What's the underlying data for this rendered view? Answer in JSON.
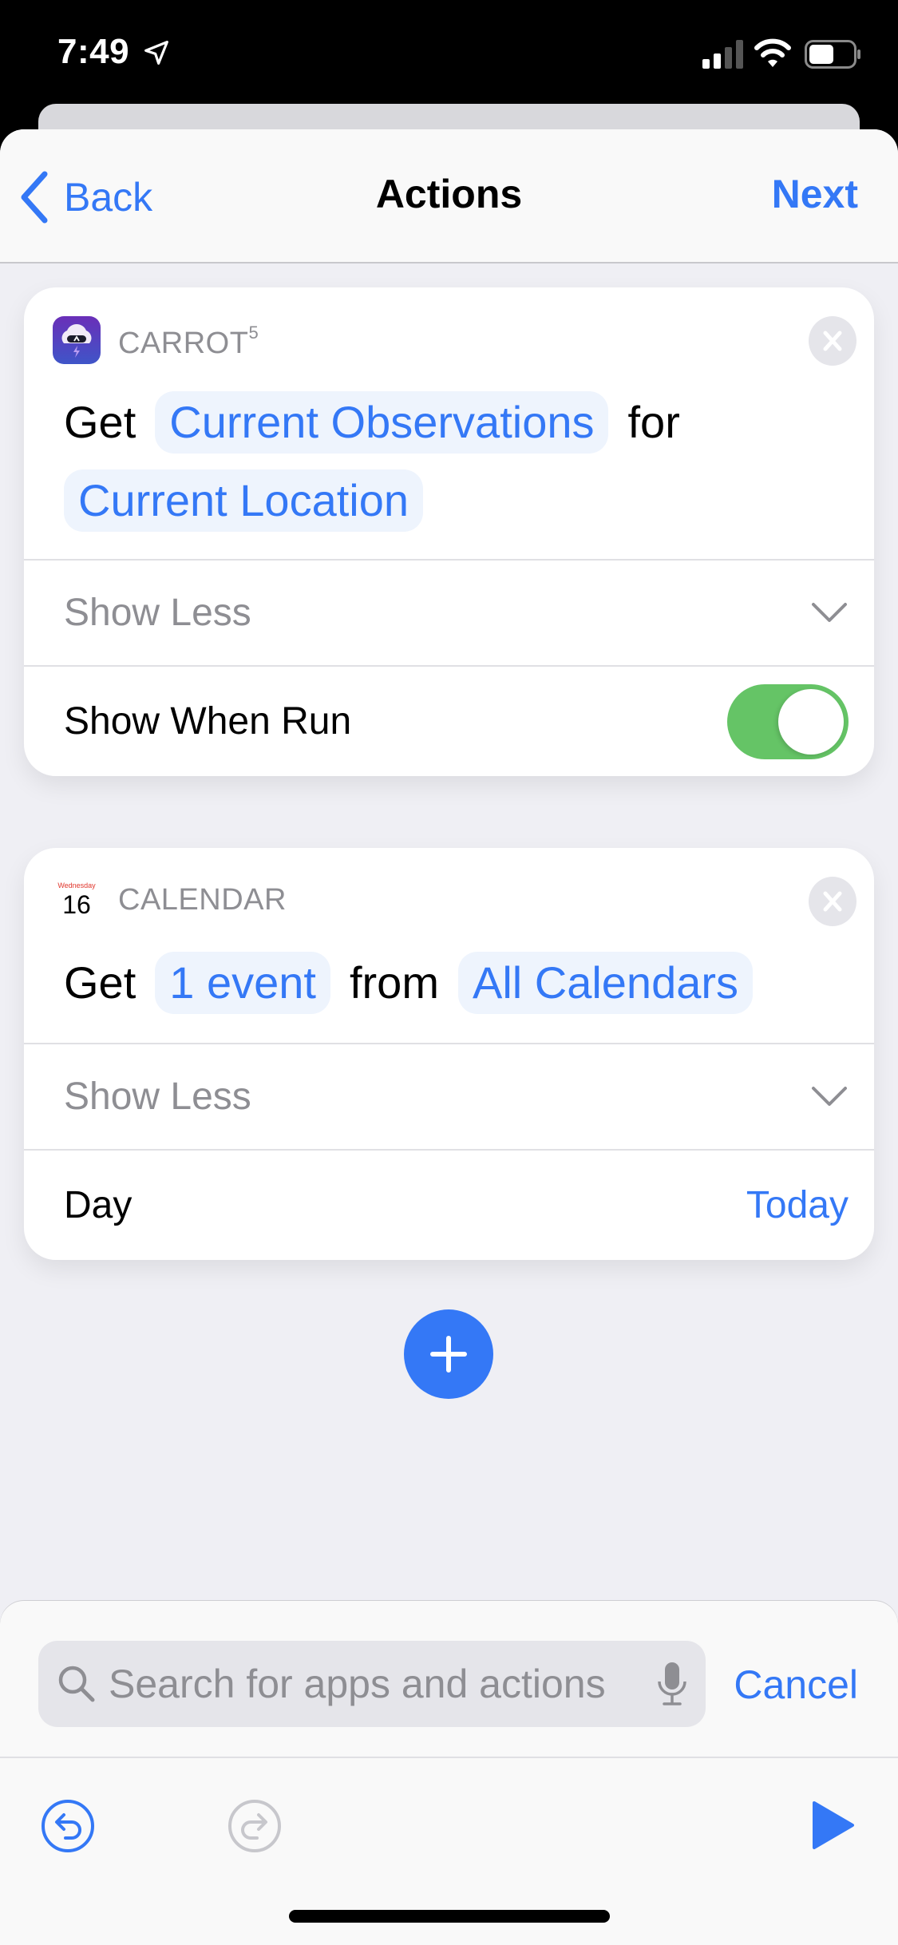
{
  "status_bar": {
    "time": "7:49",
    "icons": [
      "location-arrow-icon",
      "cellular-signal-icon",
      "wifi-icon",
      "battery-icon"
    ]
  },
  "nav": {
    "back_label": "Back",
    "title": "Actions",
    "next_label": "Next"
  },
  "actions": [
    {
      "app_name": "CARROT",
      "app_name_superscript": "5",
      "app_icon": "carrot-weather-icon",
      "sentence": {
        "prefix": "Get",
        "param1": "Current Observations",
        "connector": "for",
        "param2": "Current Location"
      },
      "show_less_label": "Show Less",
      "option_label": "Show When Run",
      "option_toggle_on": true
    },
    {
      "app_name": "CALENDAR",
      "app_icon": "calendar-icon",
      "calendar_icon_day": "Wednesday",
      "calendar_icon_date": "16",
      "sentence": {
        "prefix": "Get",
        "param1": "1 event",
        "connector": "from",
        "param2": "All Calendars"
      },
      "show_less_label": "Show Less",
      "option_label": "Day",
      "option_value": "Today"
    }
  ],
  "add_action_icon": "plus-icon",
  "search": {
    "placeholder": "Search for apps and actions",
    "value": "",
    "cancel_label": "Cancel"
  },
  "toolbar": {
    "undo_enabled": true,
    "redo_enabled": false,
    "run_icon": "play-icon"
  },
  "colors": {
    "accent": "#3478f6",
    "toggle_on": "#65c466",
    "muted_text": "#8e8e93",
    "token_bg": "#eef4fd"
  }
}
